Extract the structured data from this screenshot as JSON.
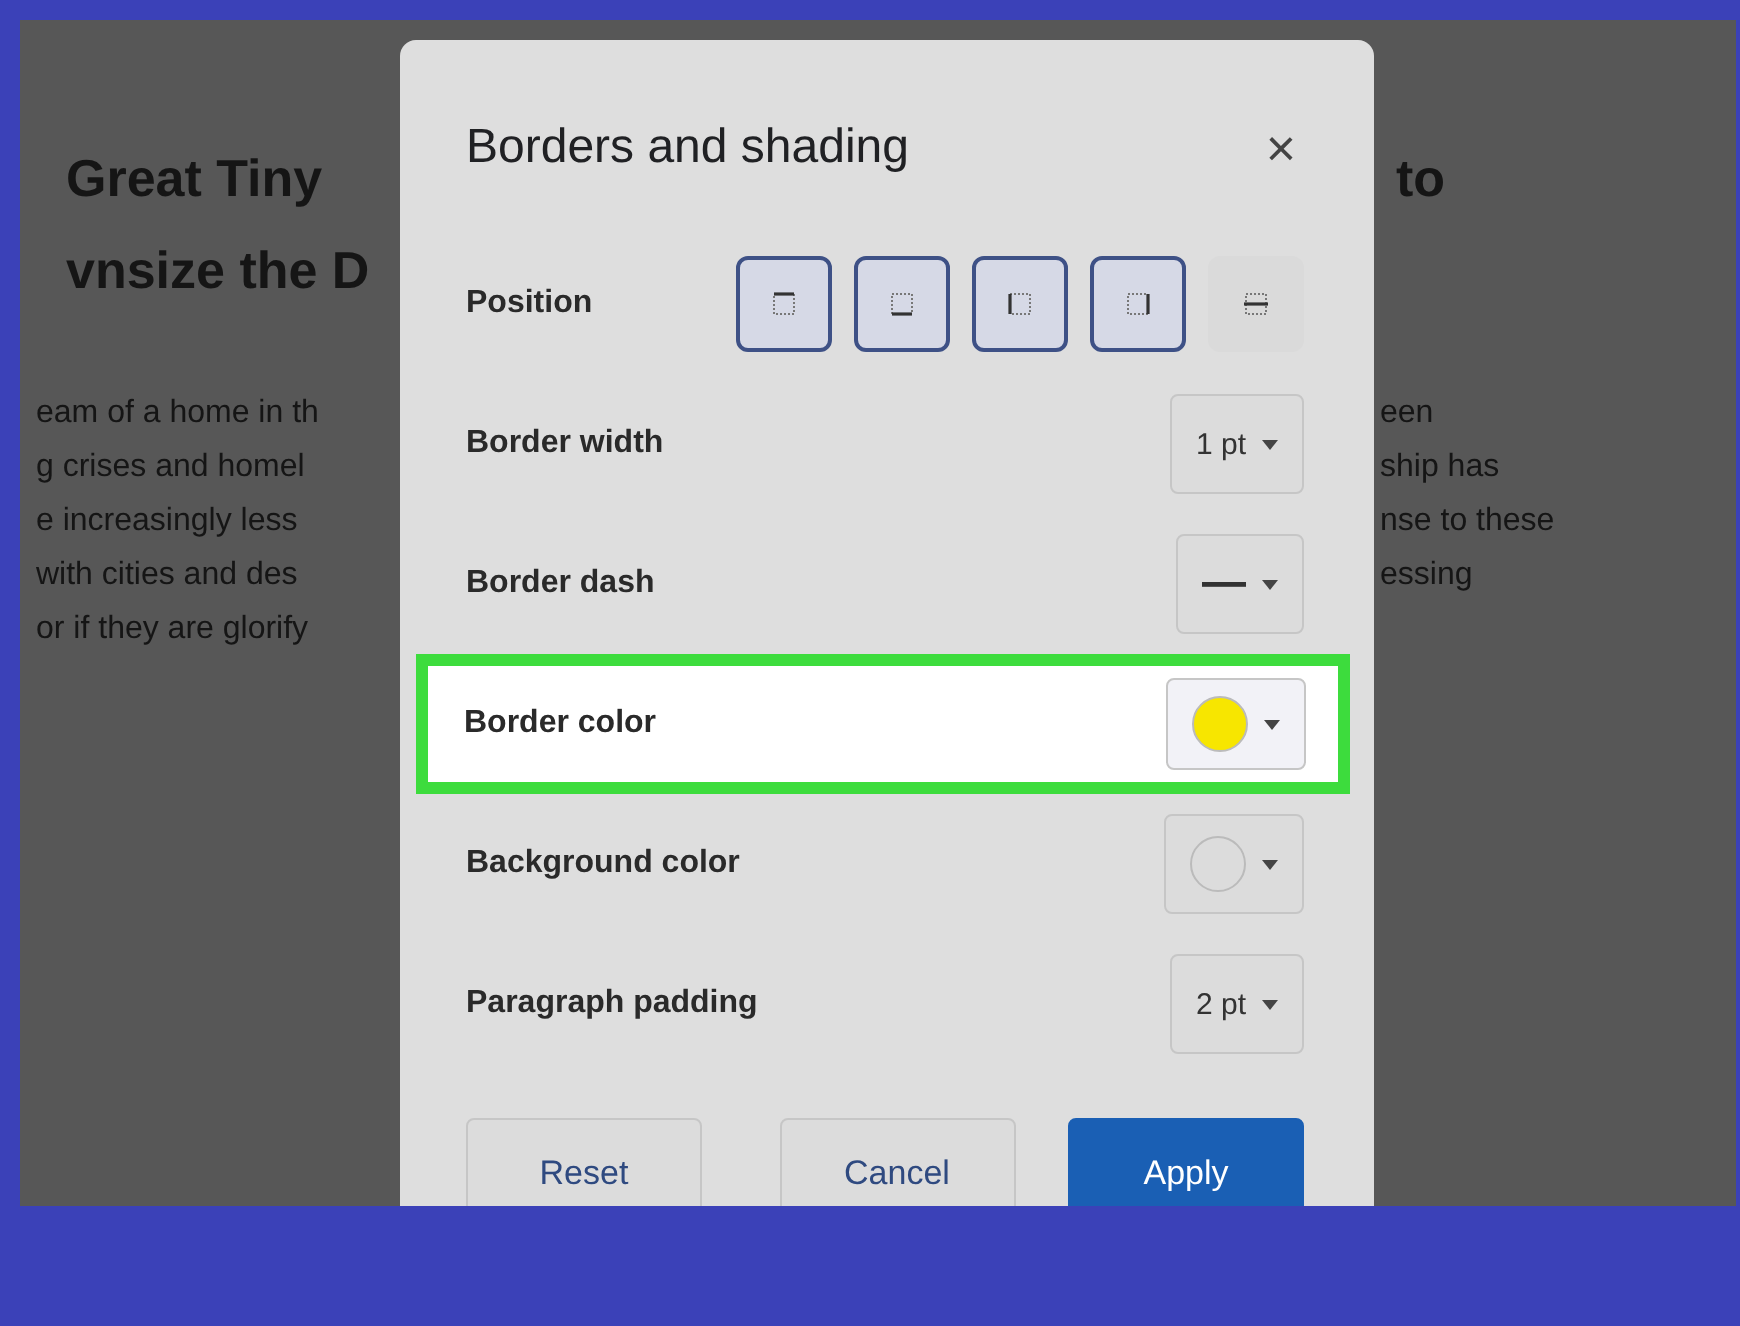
{
  "document": {
    "heading_left": [
      "Great Tiny",
      "vnsize the D"
    ],
    "heading_right": [
      "to"
    ],
    "text_left": [
      "eam of a home in th",
      "g crises and homel",
      "e increasingly less",
      "with cities and des",
      "or if they are glorify"
    ],
    "text_right": [
      "een",
      "ship has",
      "nse to these",
      "essing"
    ]
  },
  "dialog": {
    "title": "Borders and shading",
    "close": "×",
    "position": {
      "label": "Position",
      "buttons": [
        {
          "kind": "top",
          "selected": true
        },
        {
          "kind": "bottom",
          "selected": true
        },
        {
          "kind": "left",
          "selected": true
        },
        {
          "kind": "right",
          "selected": true
        },
        {
          "kind": "between",
          "selected": false
        }
      ]
    },
    "rows": [
      {
        "kind": "dropdown",
        "label": "Border width",
        "value": "1 pt",
        "highlighted": false
      },
      {
        "kind": "dash",
        "label": "Border dash",
        "highlighted": false
      },
      {
        "kind": "color",
        "label": "Border color",
        "color": "#f7e600",
        "highlighted": true
      },
      {
        "kind": "color",
        "label": "Background color",
        "color": "#dcdcdc",
        "highlighted": false
      },
      {
        "kind": "dropdown",
        "label": "Paragraph padding",
        "value": "2 pt",
        "highlighted": false
      }
    ],
    "buttons": [
      {
        "label": "Reset",
        "primary": false
      },
      {
        "label": "Cancel",
        "primary": false
      },
      {
        "label": "Apply",
        "primary": true
      }
    ]
  }
}
